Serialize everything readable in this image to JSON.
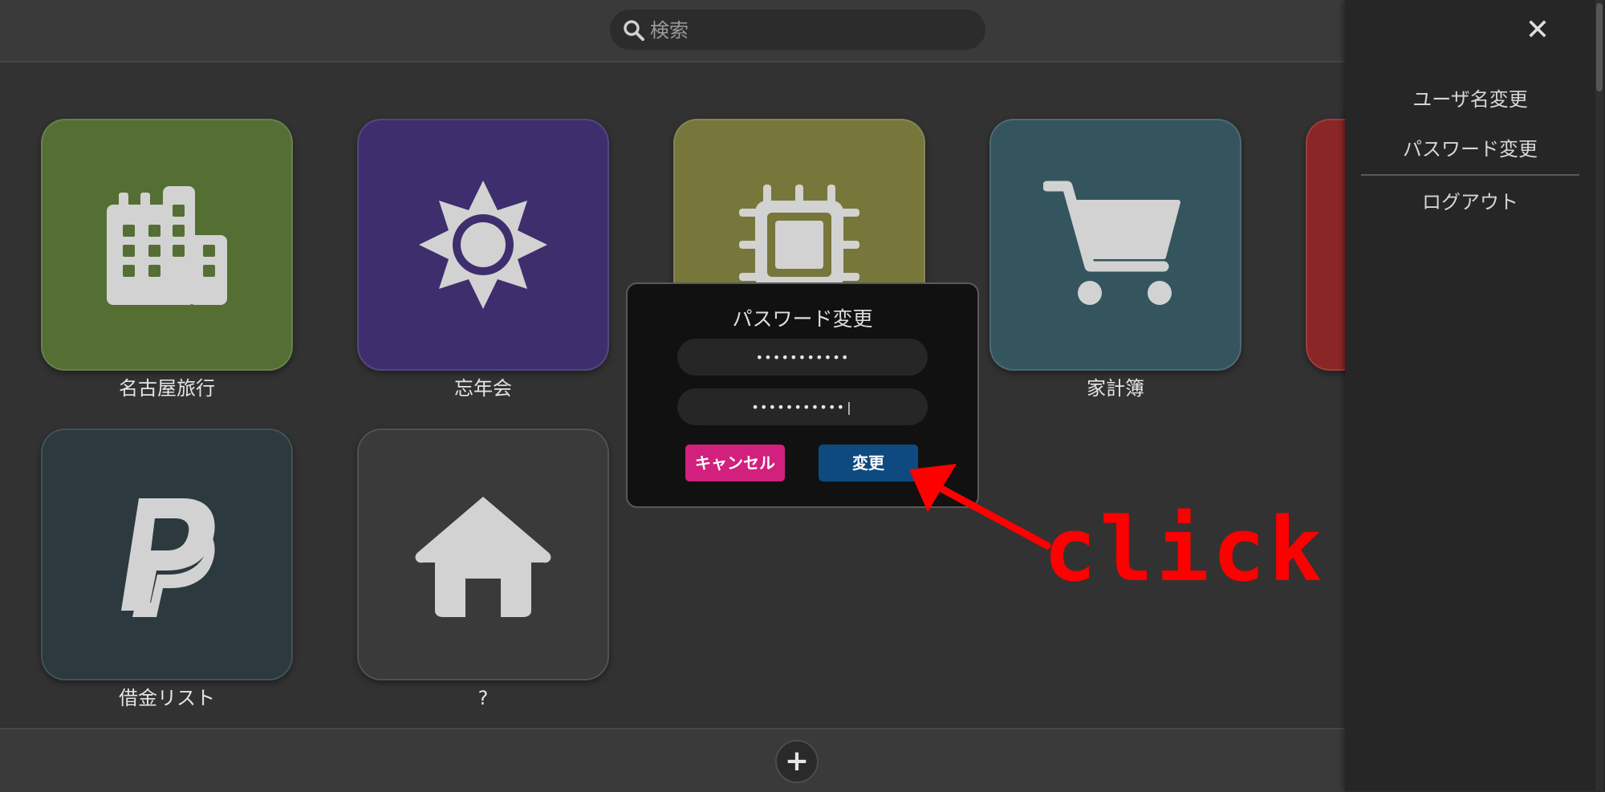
{
  "search": {
    "placeholder": "検索"
  },
  "tiles": [
    {
      "label": "名古屋旅行",
      "icon": "building-icon",
      "color": "#546e34"
    },
    {
      "label": "忘年会",
      "icon": "sun-icon",
      "color": "#3e2e6d"
    },
    {
      "label": "",
      "icon": "cpu-chip-icon",
      "color": "#77763b"
    },
    {
      "label": "家計簿",
      "icon": "shopping-cart-icon",
      "color": "#35555e"
    },
    {
      "label": "",
      "icon": "",
      "color": "#8a2625"
    },
    {
      "label": "借金リスト",
      "icon": "paypal-icon",
      "color": "#2c3a40"
    },
    {
      "label": "?",
      "icon": "home-icon",
      "color": "#3a3a3a"
    }
  ],
  "bottombar": {
    "add_label": "+"
  },
  "sidemenu": {
    "close_label": "✕",
    "items": [
      {
        "label": "ユーザ名変更"
      },
      {
        "label": "パスワード変更"
      },
      {
        "label": "ログアウト"
      }
    ]
  },
  "dialog": {
    "title": "パスワード変更",
    "current_password": "•••••••••••",
    "new_password": "•••••••••••|",
    "cancel_label": "キャンセル",
    "submit_label": "変更"
  },
  "annotation": {
    "text": "click",
    "color": "#ff0000"
  }
}
